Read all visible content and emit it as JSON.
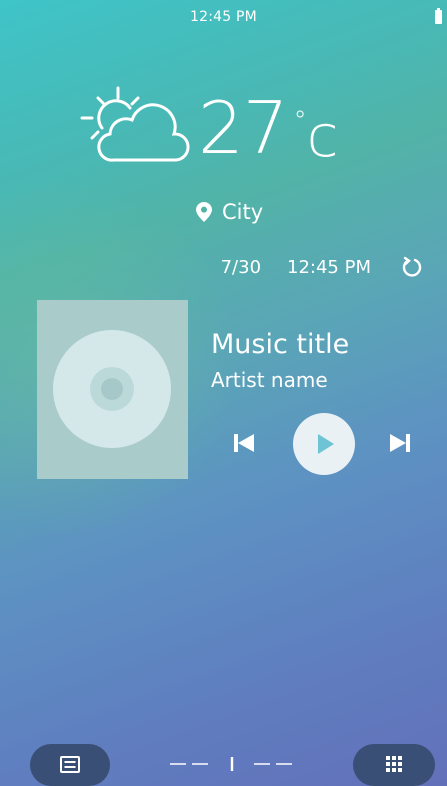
{
  "status_bar": {
    "time": "12:45 PM",
    "battery_icon": "battery-full-icon"
  },
  "weather": {
    "icon": "partly-sunny-icon",
    "temperature": "27",
    "unit": "c",
    "degree_symbol": "°",
    "location": "City",
    "location_icon": "location-pin-icon",
    "updated_date": "7/30",
    "updated_time": "12:45 PM",
    "refresh_icon": "refresh-icon"
  },
  "music": {
    "title": "Music title",
    "artist": "Artist name",
    "album_art_icon": "disc-icon",
    "controls": {
      "previous_icon": "skip-previous-icon",
      "play_icon": "play-icon",
      "next_icon": "skip-next-icon"
    }
  },
  "bottom_bar": {
    "left_button_icon": "notes-icon",
    "right_button_icon": "apps-grid-icon",
    "page_indicator": {
      "pages": 5,
      "current": 3
    }
  },
  "colors": {
    "background_top": "#3fc4c8",
    "background_bottom": "#6270ba",
    "album_bg": "#a9cbc9",
    "play_button_bg": "#e9f1f5",
    "play_icon": "#6ec3d4",
    "bottom_button_bg": "#3a4f75"
  }
}
